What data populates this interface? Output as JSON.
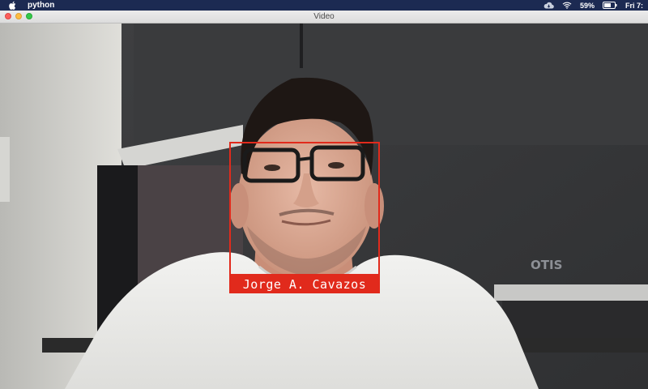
{
  "menubar": {
    "app_name": "python",
    "clock": "Fri 7:",
    "battery_percent": "59%",
    "icons": [
      "apple-icon",
      "cloud-icon",
      "wifi-icon",
      "battery-icon"
    ]
  },
  "window": {
    "title": "Video",
    "controls": [
      "close",
      "minimize",
      "maximize"
    ]
  },
  "video": {
    "detections": [
      {
        "label": "Jorge A. Cavazos",
        "color": "#e12a1c"
      }
    ],
    "background_text": "OTIS"
  }
}
